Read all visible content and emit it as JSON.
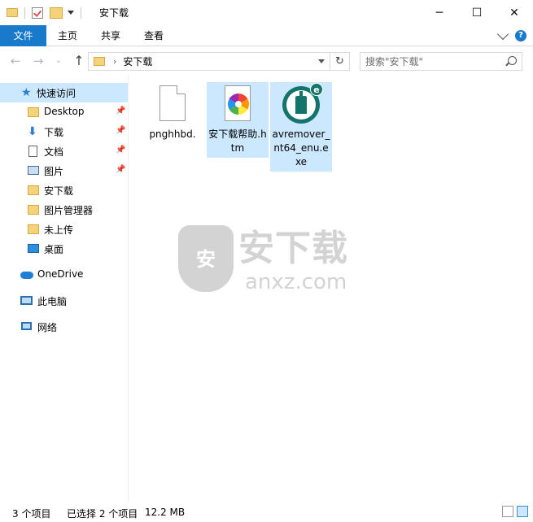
{
  "window": {
    "title": "安下载",
    "minimize_glyph": "─",
    "maximize_glyph": "☐",
    "close_glyph": "✕"
  },
  "ribbon": {
    "tabs": [
      {
        "label": "文件",
        "active": true
      },
      {
        "label": "主页"
      },
      {
        "label": "共享"
      },
      {
        "label": "查看"
      }
    ],
    "help_glyph": "?"
  },
  "address": {
    "breadcrumb": "安下载",
    "crumb_separator": "›",
    "search_placeholder": "搜索\"安下载\"",
    "nav_back_glyph": "←",
    "nav_forward_glyph": "→",
    "nav_recent_glyph": "⌄",
    "nav_up_glyph": "↑",
    "refresh_glyph": "↻"
  },
  "sidebar": {
    "items": [
      {
        "label": "快速访问",
        "icon": "star-icon",
        "selected": true
      },
      {
        "label": "Desktop",
        "icon": "folder-icon",
        "pinned": true
      },
      {
        "label": "下载",
        "icon": "download-arrow-icon",
        "pinned": true
      },
      {
        "label": "文档",
        "icon": "document-icon",
        "pinned": true
      },
      {
        "label": "图片",
        "icon": "picture-icon",
        "pinned": true
      },
      {
        "label": "安下载",
        "icon": "folder-icon"
      },
      {
        "label": "图片管理器",
        "icon": "folder-icon"
      },
      {
        "label": "未上传",
        "icon": "folder-icon"
      },
      {
        "label": "桌面",
        "icon": "desktop-icon"
      },
      {
        "label": "OneDrive",
        "icon": "cloud-icon"
      },
      {
        "label": "此电脑",
        "icon": "computer-icon"
      },
      {
        "label": "网络",
        "icon": "network-icon"
      }
    ],
    "pin_glyph": "📌",
    "star_glyph": "★",
    "down_glyph": "⬇"
  },
  "files": [
    {
      "name": "pnghhbd.",
      "icon": "blank-file-icon",
      "selected": false
    },
    {
      "name": "安下载帮助.htm",
      "icon": "htm-file-icon",
      "selected": true
    },
    {
      "name": "avremover_nt64_enu.exe",
      "icon": "eset-remover-icon",
      "selected": true,
      "badge": "e"
    }
  ],
  "watermark": {
    "shield_char": "安",
    "title": "安下载",
    "domain": "anxz.com"
  },
  "status": {
    "item_count": "3 个项目",
    "selected_count": "已选择 2 个项目",
    "selected_size": "12.2 MB"
  }
}
